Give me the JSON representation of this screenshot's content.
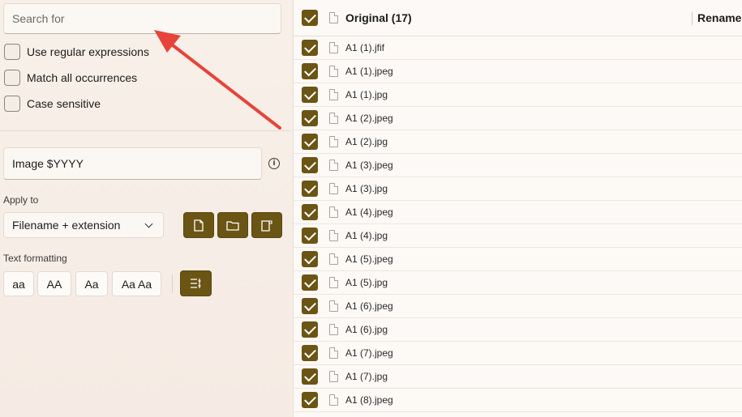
{
  "search": {
    "placeholder": "Search for"
  },
  "options": [
    {
      "label": "Use regular expressions"
    },
    {
      "label": "Match all occurrences"
    },
    {
      "label": "Case sensitive"
    }
  ],
  "replace": {
    "value": "Image $YYYY",
    "info_icon": "i"
  },
  "apply_to": {
    "label": "Apply to",
    "selected": "Filename + extension"
  },
  "text_formatting": {
    "label": "Text formatting",
    "buttons": [
      "aa",
      "AA",
      "Aa",
      "Aa Aa"
    ]
  },
  "file_list": {
    "header_original": "Original (17)",
    "header_renamed": "Renamed",
    "files": [
      "A1 (1).jfif",
      "A1 (1).jpeg",
      "A1 (1).jpg",
      "A1 (2).jpeg",
      "A1 (2).jpg",
      "A1 (3).jpeg",
      "A1 (3).jpg",
      "A1 (4).jpeg",
      "A1 (4).jpg",
      "A1 (5).jpeg",
      "A1 (5).jpg",
      "A1 (6).jpeg",
      "A1 (6).jpg",
      "A1 (7).jpeg",
      "A1 (7).jpg",
      "A1 (8).jpeg"
    ]
  },
  "colors": {
    "accent": "#6b5514",
    "annotation_arrow": "#e8433a"
  }
}
